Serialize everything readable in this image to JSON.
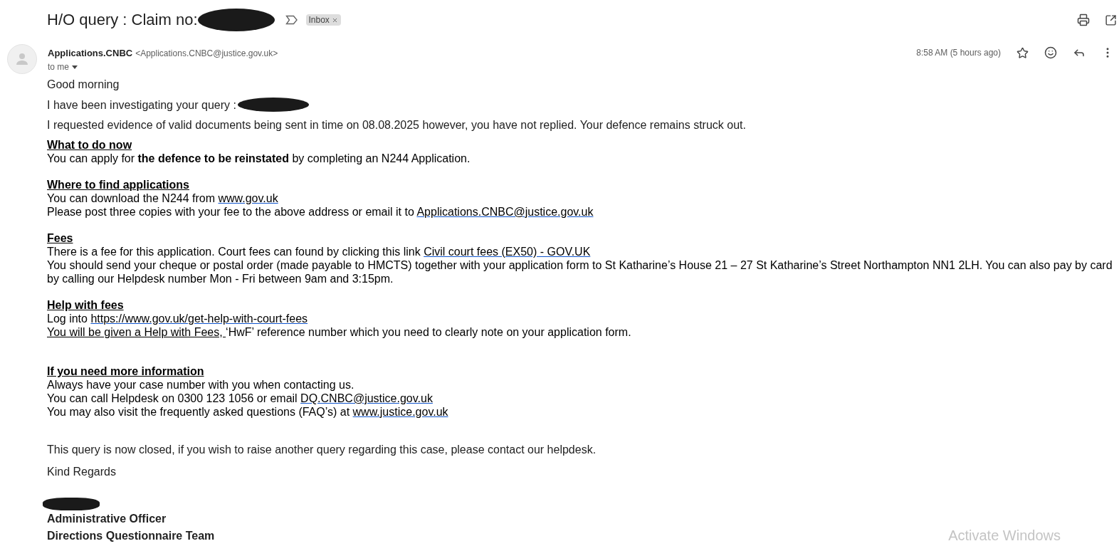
{
  "subject": {
    "text": "H/O query : Claim no:",
    "label": "Inbox"
  },
  "sender": {
    "name": "Applications.CNBC",
    "email": "<Applications.CNBC@justice.gov.uk>",
    "recipient": "to me",
    "time": "8:58 AM (5 hours ago)",
    "starred": false
  },
  "body": [
    {
      "kind": "para",
      "parts": [
        {
          "kind": "text",
          "text": "Good morning"
        }
      ]
    },
    {
      "kind": "para",
      "parts": [
        {
          "kind": "text",
          "text": "I have been investigating your query :"
        },
        {
          "kind": "redaction"
        }
      ]
    },
    {
      "kind": "para",
      "parts": [
        {
          "kind": "text",
          "text": "I requested evidence of valid documents being sent in time on 08.08.2025 however, you have not replied. Your defence remains struck out."
        }
      ]
    },
    {
      "kind": "section",
      "heading": "What to do now",
      "lines": [
        [
          {
            "kind": "text",
            "text": "You can apply for **the defence to be reinstated** by completing an N244 Application."
          }
        ]
      ]
    },
    {
      "kind": "section",
      "heading": "Where to find applications",
      "lines": [
        [
          {
            "kind": "text",
            "text": "You can download the N244 from "
          },
          {
            "kind": "link",
            "text": "www.gov.uk"
          }
        ],
        [
          {
            "kind": "text",
            "text": "Please post three copies with your fee to the above address or email it to "
          },
          {
            "kind": "link",
            "text": "Applications.CNBC@justice.gov.uk"
          }
        ]
      ]
    },
    {
      "kind": "section",
      "heading": "Fees",
      "lines": [
        [
          {
            "kind": "text",
            "text": "There is a fee for this application. Court fees can found by clicking this link "
          },
          {
            "kind": "link",
            "text": "Civil court fees (EX50) - GOV.UK"
          }
        ],
        [
          {
            "kind": "text",
            "text": "You should send your cheque or postal order (made payable to HMCTS) together with your application form to St Katharine’s House 21 – 27 St Katharine’s Street Northampton NN1 2LH. You can also pay by card by calling our Helpdesk number Mon - Fri between 9am and 3:15pm."
          }
        ]
      ]
    },
    {
      "kind": "section",
      "heading": "Help with fees",
      "lines": [
        [
          {
            "kind": "text",
            "text": "Log into "
          },
          {
            "kind": "link",
            "text": "https://www.gov.uk/get-help-with-court-fees"
          }
        ],
        [
          {
            "kind": "underline",
            "text": "You will be given a Help with Fees, "
          },
          {
            "kind": "text",
            "text": "‘HwF’ reference number which you need to clearly note on your application form."
          }
        ]
      ]
    },
    {
      "kind": "spaced-section",
      "heading": "If you need more information",
      "lines": [
        [
          {
            "kind": "text",
            "text": "Always have your case number with you when contacting us."
          }
        ],
        [
          {
            "kind": "text",
            "text": "You can call Helpdesk on 0300 123 1056 or email  "
          },
          {
            "kind": "link",
            "text": "DQ.CNBC@justice.gov.uk"
          }
        ],
        [
          {
            "kind": "text",
            "text": "You may also visit the frequently asked questions (FAQ’s) at  "
          },
          {
            "kind": "link",
            "text": "www.justice.gov.uk"
          }
        ]
      ]
    },
    {
      "kind": "closing",
      "parts": [
        {
          "kind": "text",
          "text": "This query is now closed, if you wish to raise another query regarding this case, please contact our helpdesk."
        }
      ]
    },
    {
      "kind": "para",
      "parts": [
        {
          "kind": "text",
          "text": "Kind Regards"
        }
      ]
    },
    {
      "kind": "signature",
      "lines": [
        "Administrative Officer",
        "Directions Questionnaire Team"
      ]
    }
  ],
  "overlay": {
    "text": "Activate Windows"
  }
}
